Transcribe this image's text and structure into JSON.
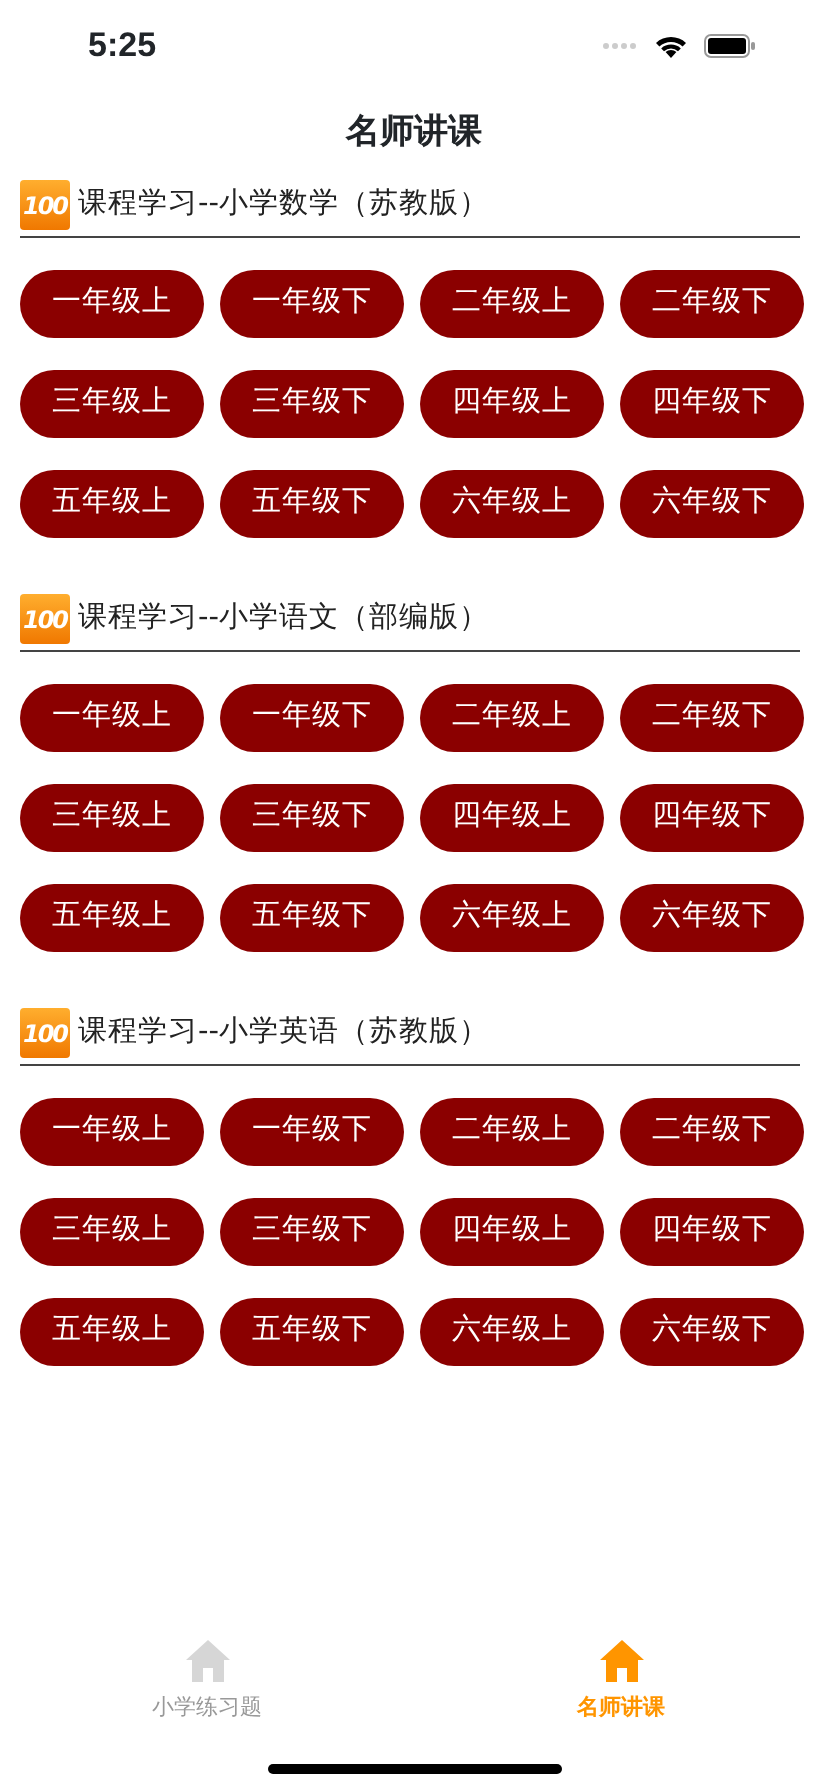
{
  "status_bar": {
    "time": "5:25"
  },
  "nav_bar": {
    "title": "名师讲课"
  },
  "sections": [
    {
      "logo": "100",
      "title": "课程学习--小学数学（苏教版）",
      "buttons": [
        "一年级上",
        "一年级下",
        "二年级上",
        "二年级下",
        "三年级上",
        "三年级下",
        "四年级上",
        "四年级下",
        "五年级上",
        "五年级下",
        "六年级上",
        "六年级下"
      ]
    },
    {
      "logo": "100",
      "title": "课程学习--小学语文（部编版）",
      "buttons": [
        "一年级上",
        "一年级下",
        "二年级上",
        "二年级下",
        "三年级上",
        "三年级下",
        "四年级上",
        "四年级下",
        "五年级上",
        "五年级下",
        "六年级上",
        "六年级下"
      ]
    },
    {
      "logo": "100",
      "title": "课程学习--小学英语（苏教版）",
      "buttons": [
        "一年级上",
        "一年级下",
        "二年级上",
        "二年级下",
        "三年级上",
        "三年级下",
        "四年级上",
        "四年级下",
        "五年级上",
        "五年级下",
        "六年级上",
        "六年级下"
      ]
    }
  ],
  "tab_bar": [
    {
      "label": "小学练习题",
      "selected": false
    },
    {
      "label": "名师讲课",
      "selected": true
    }
  ]
}
